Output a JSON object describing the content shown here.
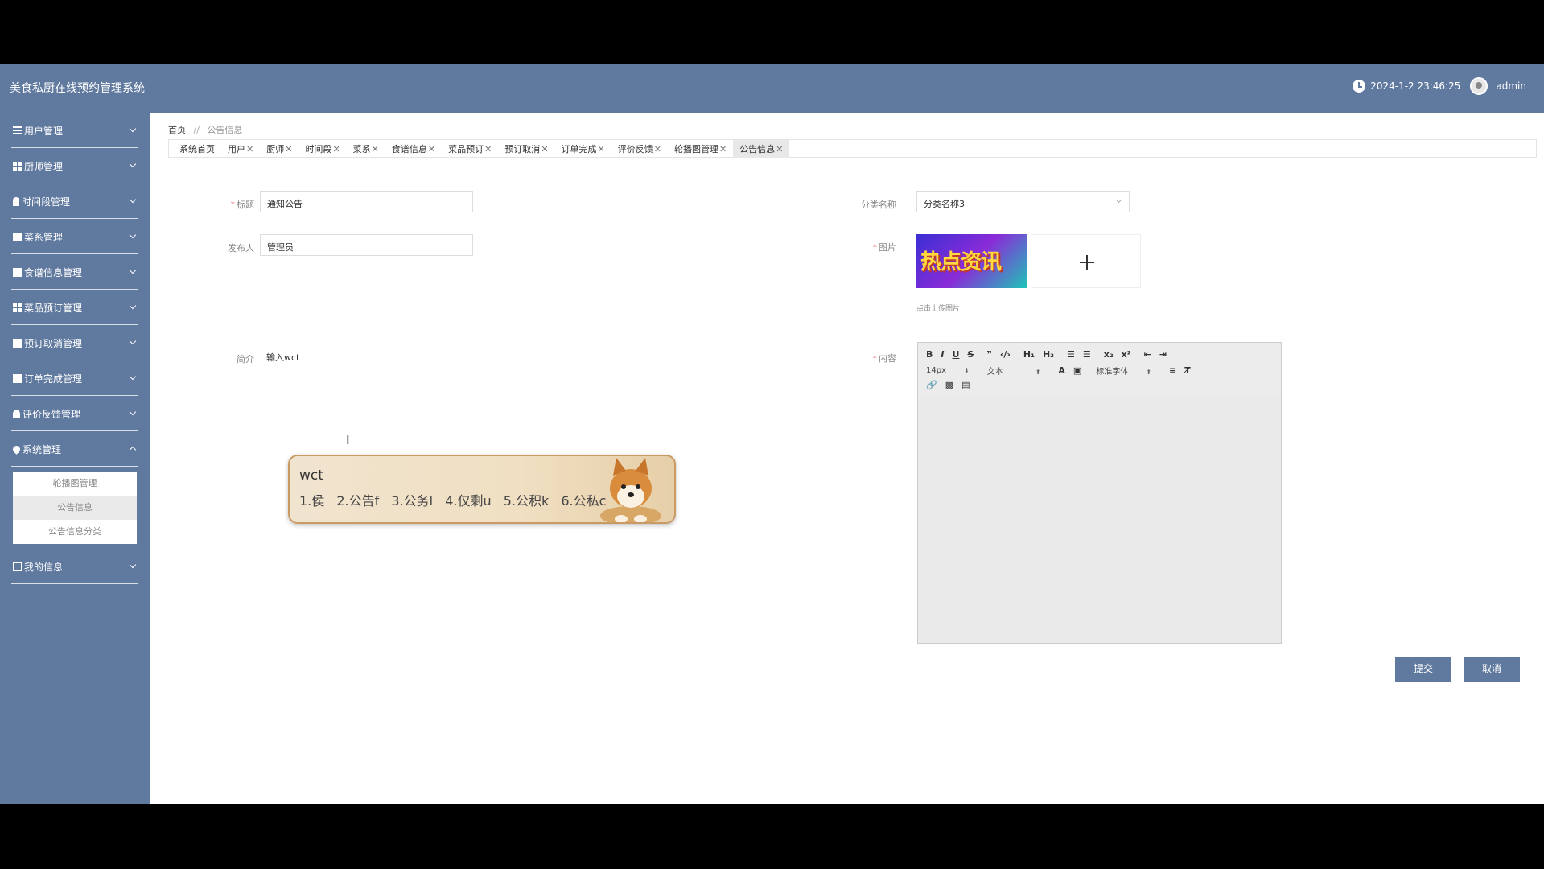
{
  "app": {
    "title": "美食私厨在线预约管理系统"
  },
  "header": {
    "datetime": "2024-1-2 23:46:25",
    "username": "admin"
  },
  "sidebar": {
    "items": [
      {
        "label": "用户管理",
        "icon": "list-icon"
      },
      {
        "label": "厨师管理",
        "icon": "grid-icon"
      },
      {
        "label": "时间段管理",
        "icon": "pin-icon"
      },
      {
        "label": "菜系管理",
        "icon": "thumb-icon"
      },
      {
        "label": "食谱信息管理",
        "icon": "square-icon"
      },
      {
        "label": "菜品预订管理",
        "icon": "grid-icon"
      },
      {
        "label": "预订取消管理",
        "icon": "monitor-icon"
      },
      {
        "label": "订单完成管理",
        "icon": "clipboard-icon"
      },
      {
        "label": "评价反馈管理",
        "icon": "user-icon"
      },
      {
        "label": "系统管理",
        "icon": "location-icon"
      },
      {
        "label": "我的信息",
        "icon": "card-icon"
      }
    ],
    "submenu": [
      "轮播图管理",
      "公告信息",
      "公告信息分类"
    ]
  },
  "breadcrumb": {
    "home": "首页",
    "sep": "//",
    "current": "公告信息"
  },
  "tabs": [
    "系统首页",
    "用户",
    "厨师",
    "时间段",
    "菜系",
    "食谱信息",
    "菜品预订",
    "预订取消",
    "订单完成",
    "评价反馈",
    "轮播图管理",
    "公告信息"
  ],
  "form": {
    "title_label": "标题",
    "title_value": "通知公告",
    "publisher_label": "发布人",
    "publisher_value": "管理员",
    "intro_label": "简介",
    "intro_value": "输入wct",
    "category_label": "分类名称",
    "category_value": "分类名称3",
    "image_label": "图片",
    "image_text": "热点资讯",
    "upload_hint": "点击上传图片",
    "content_label": "内容",
    "required_mark": "*"
  },
  "editor": {
    "font_size": "14px",
    "block_type": "文本",
    "font_family": "标准字体"
  },
  "buttons": {
    "submit": "提交",
    "cancel": "取消"
  },
  "ime": {
    "composition": "wct",
    "candidates": [
      "1.侯",
      "2.公告f",
      "3.公务l",
      "4.仅剩u",
      "5.公积k",
      "6.公私c"
    ]
  }
}
